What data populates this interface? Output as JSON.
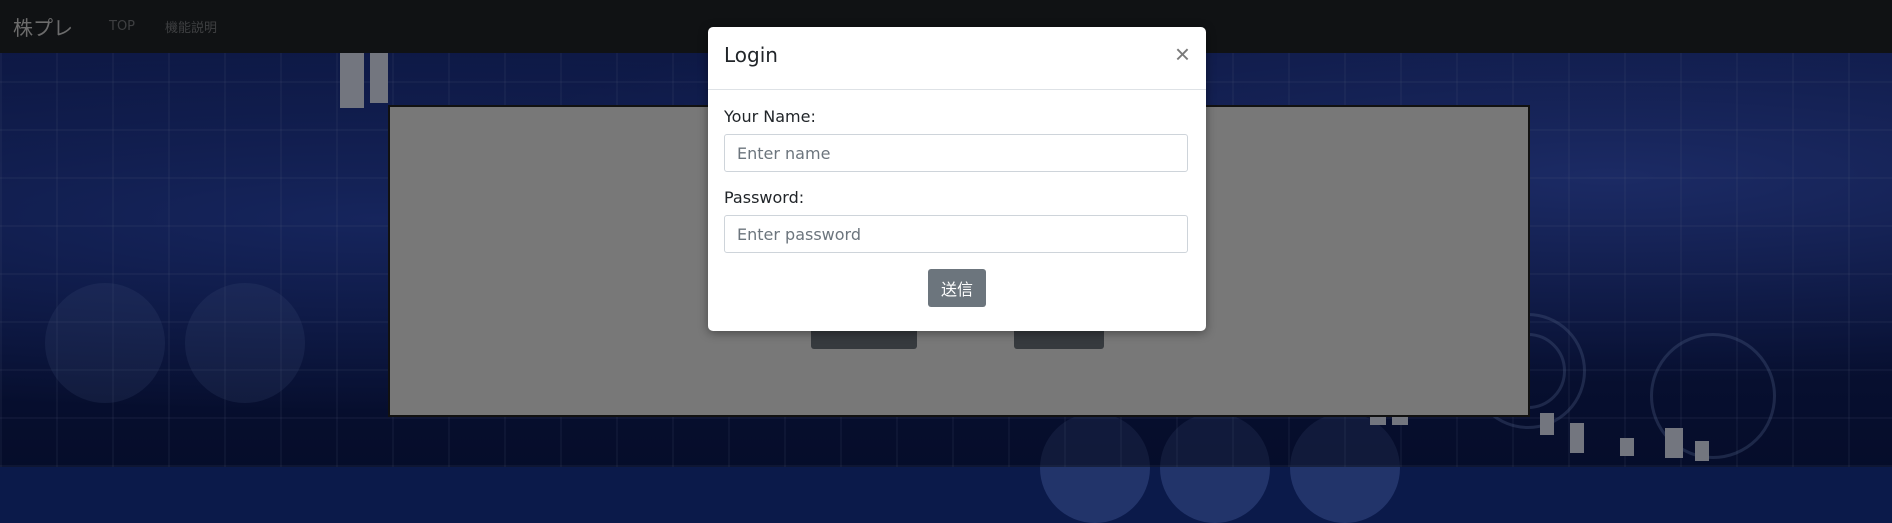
{
  "navbar": {
    "brand": "株プレ",
    "links": [
      "TOP",
      "機能説明"
    ]
  },
  "modal": {
    "title": "Login",
    "close_label": "×",
    "name_label": "Your Name:",
    "name_placeholder": "Enter name",
    "password_label": "Password:",
    "password_placeholder": "Enter password",
    "submit_label": "送信"
  },
  "colors": {
    "navbar_bg": "#212529",
    "button_bg": "#6c757d",
    "backdrop": "rgba(0,0,0,0.5)"
  }
}
